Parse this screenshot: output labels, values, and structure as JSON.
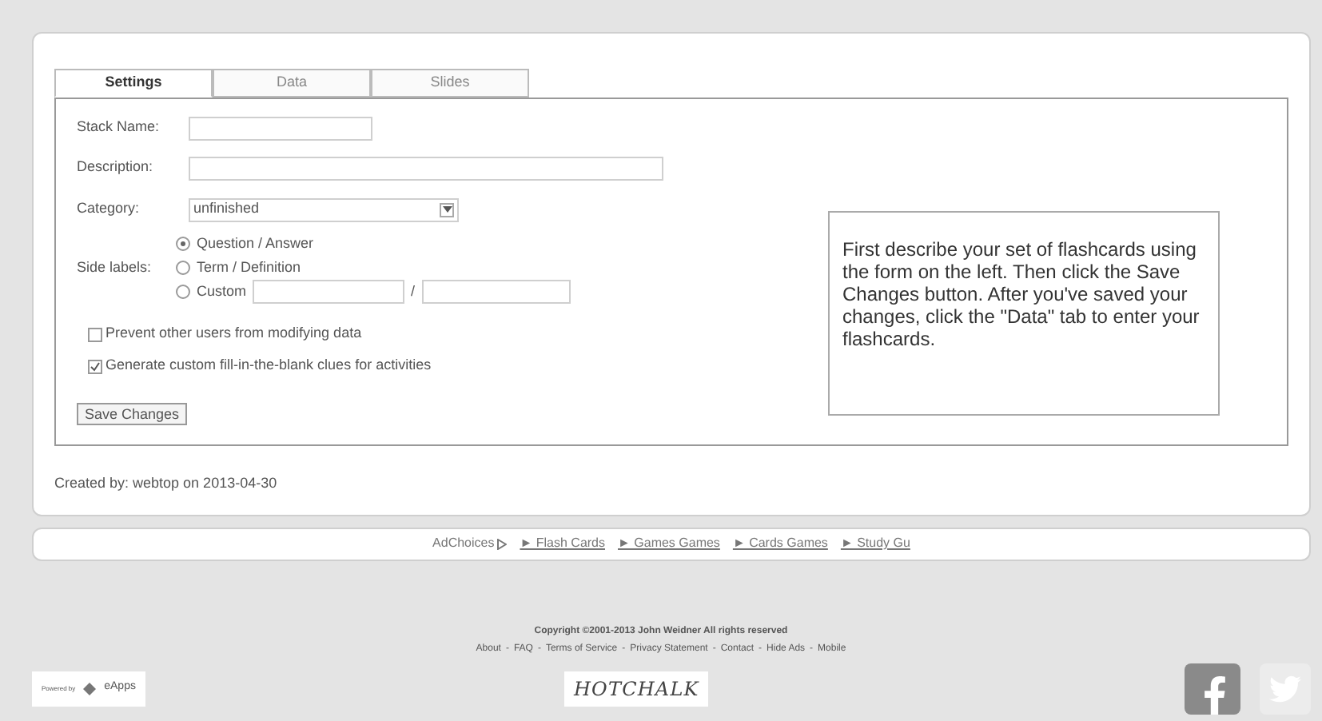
{
  "tabs": [
    {
      "label": "Settings",
      "selected": true
    },
    {
      "label": "Data",
      "selected": false
    },
    {
      "label": "Slides",
      "selected": false
    }
  ],
  "form": {
    "stack_name": {
      "label": "Stack Name:"
    },
    "description": {
      "label": "Description:"
    },
    "category": {
      "label": "Category:",
      "value": "unfinished"
    },
    "side_labels": {
      "label": "Side labels:",
      "options": [
        {
          "label": "Question / Answer",
          "selected": true,
          "kind": "plain"
        },
        {
          "label": "Term / Definition",
          "selected": false,
          "kind": "plain"
        },
        {
          "label": "Custom",
          "selected": false,
          "kind": "custom",
          "divider": "/"
        }
      ]
    },
    "checkboxes": [
      {
        "label": "Prevent other users from modifying data",
        "checked": false
      },
      {
        "label": "Generate custom fill-in-the-blank clues for activities",
        "checked": true
      }
    ]
  },
  "save_button": "Save Changes",
  "info_text": "First describe your set of flashcards using the form on the left. Then click the Save Changes button. After you've saved your changes, click the \"Data\" tab to enter your flashcards.",
  "created_by": "Created by: webtop on 2013-04-30",
  "ad_bar": {
    "adchoices": "AdChoices",
    "links": [
      "► Flash Cards",
      "► Games Games",
      "► Cards Games",
      "► Study Gu"
    ]
  },
  "footer": {
    "copyright": "Copyright ©2001-2013 John Weidner All rights reserved",
    "separator": "-",
    "links": [
      "About",
      "FAQ",
      "Terms of Service",
      "Privacy Statement",
      "Contact",
      "Hide Ads",
      "Mobile"
    ],
    "powered_by": {
      "prefix": "Powered by",
      "name": "eApps"
    },
    "logo": "HOTCHALK"
  }
}
